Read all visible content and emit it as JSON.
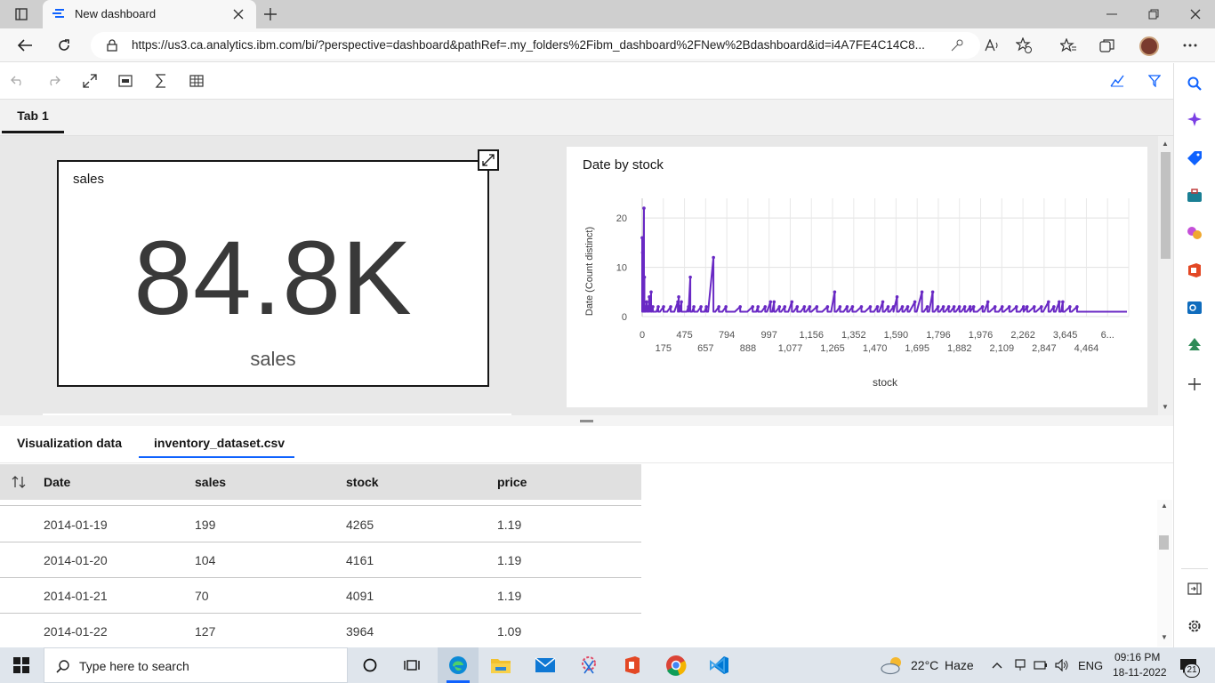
{
  "browser": {
    "tab_title": "New dashboard",
    "url": "https://us3.ca.analytics.ibm.com/bi/?perspective=dashboard&pathRef=.my_folders%2Fibm_dashboard%2FNew%2Bdashboard&id=i4A7FE4C14C8..."
  },
  "dashboard": {
    "tab_label": "Tab 1",
    "kpi": {
      "title": "sales",
      "value": "84.8K",
      "label": "sales"
    }
  },
  "chart_data": {
    "type": "line",
    "title": "Date by stock",
    "xlabel": "stock",
    "ylabel": "Date (Count distinct)",
    "ylim": [
      0,
      24
    ],
    "yticks": [
      "0",
      "10",
      "20"
    ],
    "xticks_row1": [
      "0",
      "475",
      "794",
      "997",
      "1,156",
      "1,352",
      "1,590",
      "1,796",
      "1,976",
      "2,262",
      "3,645",
      "6..."
    ],
    "xticks_row2": [
      "175",
      "657",
      "888",
      "1,077",
      "1,265",
      "1,470",
      "1,695",
      "1,882",
      "2,109",
      "2,847",
      "4,464"
    ],
    "grid": true,
    "color": "#6929c4",
    "points": [
      [
        0,
        16
      ],
      [
        0.5,
        13
      ],
      [
        1,
        2
      ],
      [
        1.3,
        5
      ],
      [
        2,
        22
      ],
      [
        2.5,
        8
      ],
      [
        3,
        2
      ],
      [
        4,
        1
      ],
      [
        5,
        3
      ],
      [
        6,
        2
      ],
      [
        7,
        1
      ],
      [
        8,
        4
      ],
      [
        9,
        2
      ],
      [
        10,
        5
      ],
      [
        11,
        1
      ],
      [
        12,
        2
      ],
      [
        14,
        1
      ],
      [
        16,
        1
      ],
      [
        18,
        2
      ],
      [
        20,
        1
      ],
      [
        24,
        2
      ],
      [
        28,
        1
      ],
      [
        32,
        2
      ],
      [
        36,
        1
      ],
      [
        40,
        3
      ],
      [
        41,
        4
      ],
      [
        42,
        2
      ],
      [
        44,
        3
      ],
      [
        46,
        1
      ],
      [
        50,
        1
      ],
      [
        52,
        2
      ],
      [
        54,
        8
      ],
      [
        56,
        1
      ],
      [
        58,
        2
      ],
      [
        62,
        1
      ],
      [
        66,
        2
      ],
      [
        70,
        1
      ],
      [
        72,
        2
      ],
      [
        74,
        1
      ],
      [
        80,
        12
      ],
      [
        82,
        1
      ],
      [
        86,
        2
      ],
      [
        90,
        1
      ],
      [
        94,
        2
      ],
      [
        98,
        1
      ],
      [
        100,
        1
      ],
      [
        104,
        1
      ],
      [
        110,
        2
      ],
      [
        118,
        1
      ],
      [
        124,
        2
      ],
      [
        128,
        1
      ],
      [
        130,
        2
      ],
      [
        134,
        1
      ],
      [
        138,
        2
      ],
      [
        140,
        1
      ],
      [
        144,
        3
      ],
      [
        146,
        1
      ],
      [
        148,
        3
      ],
      [
        150,
        1
      ],
      [
        154,
        2
      ],
      [
        156,
        1
      ],
      [
        160,
        2
      ],
      [
        164,
        1
      ],
      [
        168,
        3
      ],
      [
        170,
        1
      ],
      [
        174,
        2
      ],
      [
        178,
        1
      ],
      [
        182,
        2
      ],
      [
        184,
        1
      ],
      [
        188,
        2
      ],
      [
        190,
        1
      ],
      [
        196,
        2
      ],
      [
        202,
        1
      ],
      [
        208,
        2
      ],
      [
        212,
        1
      ],
      [
        216,
        5
      ],
      [
        218,
        1
      ],
      [
        222,
        2
      ],
      [
        226,
        1
      ],
      [
        230,
        2
      ],
      [
        232,
        1
      ],
      [
        236,
        2
      ],
      [
        240,
        1
      ],
      [
        246,
        2
      ],
      [
        250,
        1
      ],
      [
        256,
        2
      ],
      [
        260,
        1
      ],
      [
        264,
        2
      ],
      [
        266,
        1
      ],
      [
        270,
        3
      ],
      [
        272,
        1
      ],
      [
        276,
        2
      ],
      [
        278,
        1
      ],
      [
        282,
        2
      ],
      [
        286,
        4
      ],
      [
        288,
        1
      ],
      [
        292,
        2
      ],
      [
        294,
        1
      ],
      [
        298,
        2
      ],
      [
        300,
        1
      ],
      [
        306,
        3
      ],
      [
        308,
        1
      ],
      [
        314,
        5
      ],
      [
        316,
        1
      ],
      [
        320,
        2
      ],
      [
        322,
        1
      ],
      [
        326,
        5
      ],
      [
        328,
        1
      ],
      [
        332,
        2
      ],
      [
        334,
        1
      ],
      [
        338,
        2
      ],
      [
        340,
        1
      ],
      [
        344,
        2
      ],
      [
        346,
        1
      ],
      [
        350,
        2
      ],
      [
        352,
        1
      ],
      [
        356,
        2
      ],
      [
        358,
        1
      ],
      [
        362,
        2
      ],
      [
        364,
        1
      ],
      [
        368,
        2
      ],
      [
        372,
        2
      ],
      [
        376,
        1
      ],
      [
        382,
        2
      ],
      [
        384,
        1
      ],
      [
        388,
        3
      ],
      [
        390,
        1
      ],
      [
        396,
        2
      ],
      [
        400,
        1
      ],
      [
        404,
        2
      ],
      [
        406,
        1
      ],
      [
        412,
        2
      ],
      [
        414,
        1
      ],
      [
        420,
        2
      ],
      [
        424,
        1
      ],
      [
        428,
        2
      ],
      [
        432,
        2
      ],
      [
        434,
        1
      ],
      [
        440,
        2
      ],
      [
        442,
        1
      ],
      [
        448,
        2
      ],
      [
        450,
        1
      ],
      [
        456,
        3
      ],
      [
        458,
        1
      ],
      [
        462,
        2
      ],
      [
        464,
        1
      ],
      [
        468,
        3
      ],
      [
        470,
        1
      ],
      [
        472,
        3
      ],
      [
        474,
        1
      ],
      [
        480,
        2
      ],
      [
        482,
        1
      ],
      [
        488,
        2
      ],
      [
        490,
        1
      ],
      [
        496,
        1
      ],
      [
        500,
        1
      ],
      [
        506,
        1
      ],
      [
        512,
        1
      ],
      [
        520,
        1
      ],
      [
        526,
        1
      ],
      [
        534,
        1
      ],
      [
        540,
        1
      ],
      [
        544,
        1
      ]
    ]
  },
  "data_panel": {
    "tabs": [
      "Visualization data",
      "inventory_dataset.csv"
    ],
    "active_tab": 1,
    "columns": [
      "Date",
      "sales",
      "stock",
      "price"
    ],
    "rows": [
      [
        "2014-01-19",
        "199",
        "4265",
        "1.19"
      ],
      [
        "2014-01-20",
        "104",
        "4161",
        "1.19"
      ],
      [
        "2014-01-21",
        "70",
        "4091",
        "1.19"
      ],
      [
        "2014-01-22",
        "127",
        "3964",
        "1.09"
      ]
    ]
  },
  "taskbar": {
    "search_placeholder": "Type here to search",
    "weather": "22°C",
    "weather_desc": "Haze",
    "lang": "ENG",
    "time": "09:16 PM",
    "date": "18-11-2022",
    "notif_count": "21"
  },
  "icons": {
    "accent_blue": "#0f62fe",
    "chart_purple": "#6929c4"
  }
}
